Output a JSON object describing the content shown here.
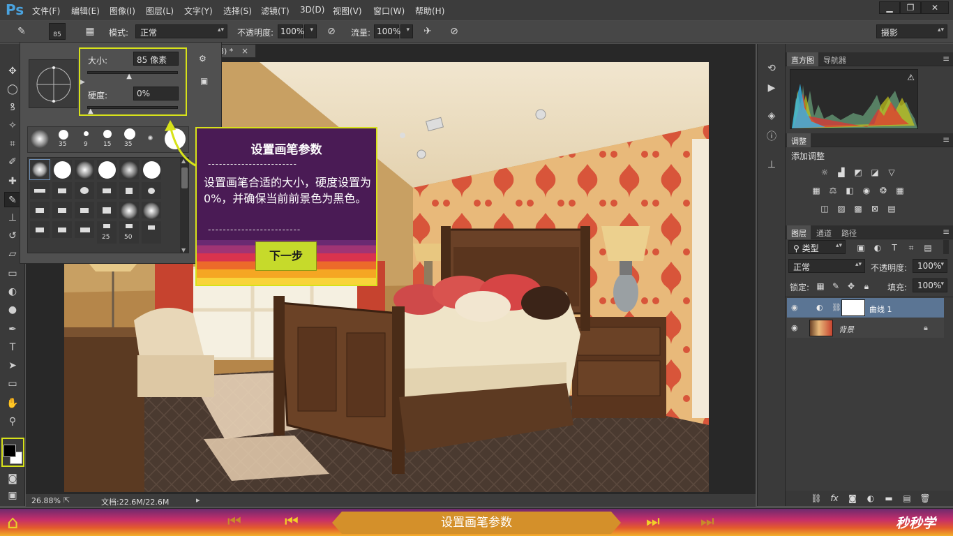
{
  "app": {
    "logo": "Ps"
  },
  "menu": [
    "文件(F)",
    "编辑(E)",
    "图像(I)",
    "图层(L)",
    "文字(Y)",
    "选择(S)",
    "滤镜(T)",
    "3D(D)",
    "视图(V)",
    "窗口(W)",
    "帮助(H)"
  ],
  "window_buttons": [
    "▁",
    "❐",
    "✕"
  ],
  "options": {
    "brush_size": "85",
    "mode_label": "模式:",
    "mode_value": "正常",
    "opacity_label": "不透明度:",
    "opacity_value": "100%",
    "flow_label": "流量:",
    "flow_value": "100%",
    "workspace": "摄影"
  },
  "document": {
    "tab_suffix": "8) *",
    "tab_close": "×"
  },
  "brush_popup": {
    "size_label": "大小:",
    "size_value": "85 像素",
    "hardness_label": "硬度:",
    "hardness_value": "0%",
    "size_level": 0.46,
    "hardness_level": 0.0,
    "recent_brushes": [
      "35",
      "9",
      "15",
      "35"
    ],
    "grid_numbers": [
      "25",
      "50"
    ]
  },
  "tip_card": {
    "title": "设置画笔参数",
    "divider": "------------------------",
    "body": "设置画笔合适的大小，硬度设置为0%，并确保当前前景色为黑色。",
    "divider2": "-------------------------",
    "next_button": "下一步"
  },
  "status": {
    "zoom": "26.88%",
    "doc_info": "文档:22.6M/22.6M"
  },
  "panels": {
    "histogram_tab": "直方图",
    "navigator_tab": "导航器",
    "warning": "⚠",
    "adjust_tab": "调整",
    "add_adjust": "添加调整",
    "layers_tab": "图层",
    "channels_tab": "通道",
    "paths_tab": "路径",
    "kind_filter": "类型",
    "blend_mode": "正常",
    "opacity_label": "不透明度:",
    "opacity_value": "100%",
    "lock_label": "锁定:",
    "fill_label": "填充:",
    "fill_value": "100%",
    "layers": [
      {
        "name": "曲线 1",
        "selected": true
      },
      {
        "name": "背景",
        "selected": false
      }
    ]
  },
  "bottom_bar": {
    "title": "设置画笔参数",
    "brand": "秒秒学"
  },
  "colors": {
    "accent": "#d7e21a",
    "card_bg": "#4a1b55",
    "ps_blue": "#4aa3df",
    "layer_selected": "#5b7594"
  }
}
